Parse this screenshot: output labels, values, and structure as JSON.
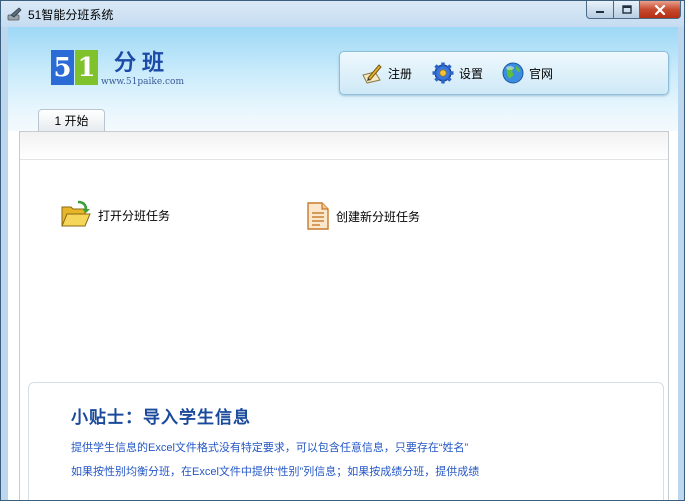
{
  "window": {
    "title": "51智能分班系统"
  },
  "logo": {
    "digit_5": "5",
    "digit_1": "1",
    "title": "分班",
    "url": "www.51paike.com"
  },
  "toolbar": {
    "register_label": "注册",
    "settings_label": "设置",
    "website_label": "官网"
  },
  "tabs": [
    {
      "label": "1 开始",
      "selected": true
    }
  ],
  "actions": {
    "open_task_label": "打开分班任务",
    "create_task_label": "创建新分班任务"
  },
  "tips": {
    "title": "小贴士：导入学生信息",
    "line1": "提供学生信息的Excel文件格式没有特定要求，可以包含任意信息，只要存在“姓名”",
    "line2": "如果按性别均衡分班，在Excel文件中提供“性别”列信息；如果按成绩分班，提供成绩"
  },
  "colors": {
    "accent_blue": "#1a4a9c",
    "tip_text": "#2457c5",
    "logo_blue": "#2a6bd6",
    "logo_green": "#7fc22c",
    "close_red": "#c64a2f"
  },
  "icons": {
    "app": "pen-app-icon",
    "register": "pen-paper-icon",
    "settings": "gear-icon",
    "website": "globe-icon",
    "open_task": "open-folder-icon",
    "create_task": "document-icon"
  }
}
